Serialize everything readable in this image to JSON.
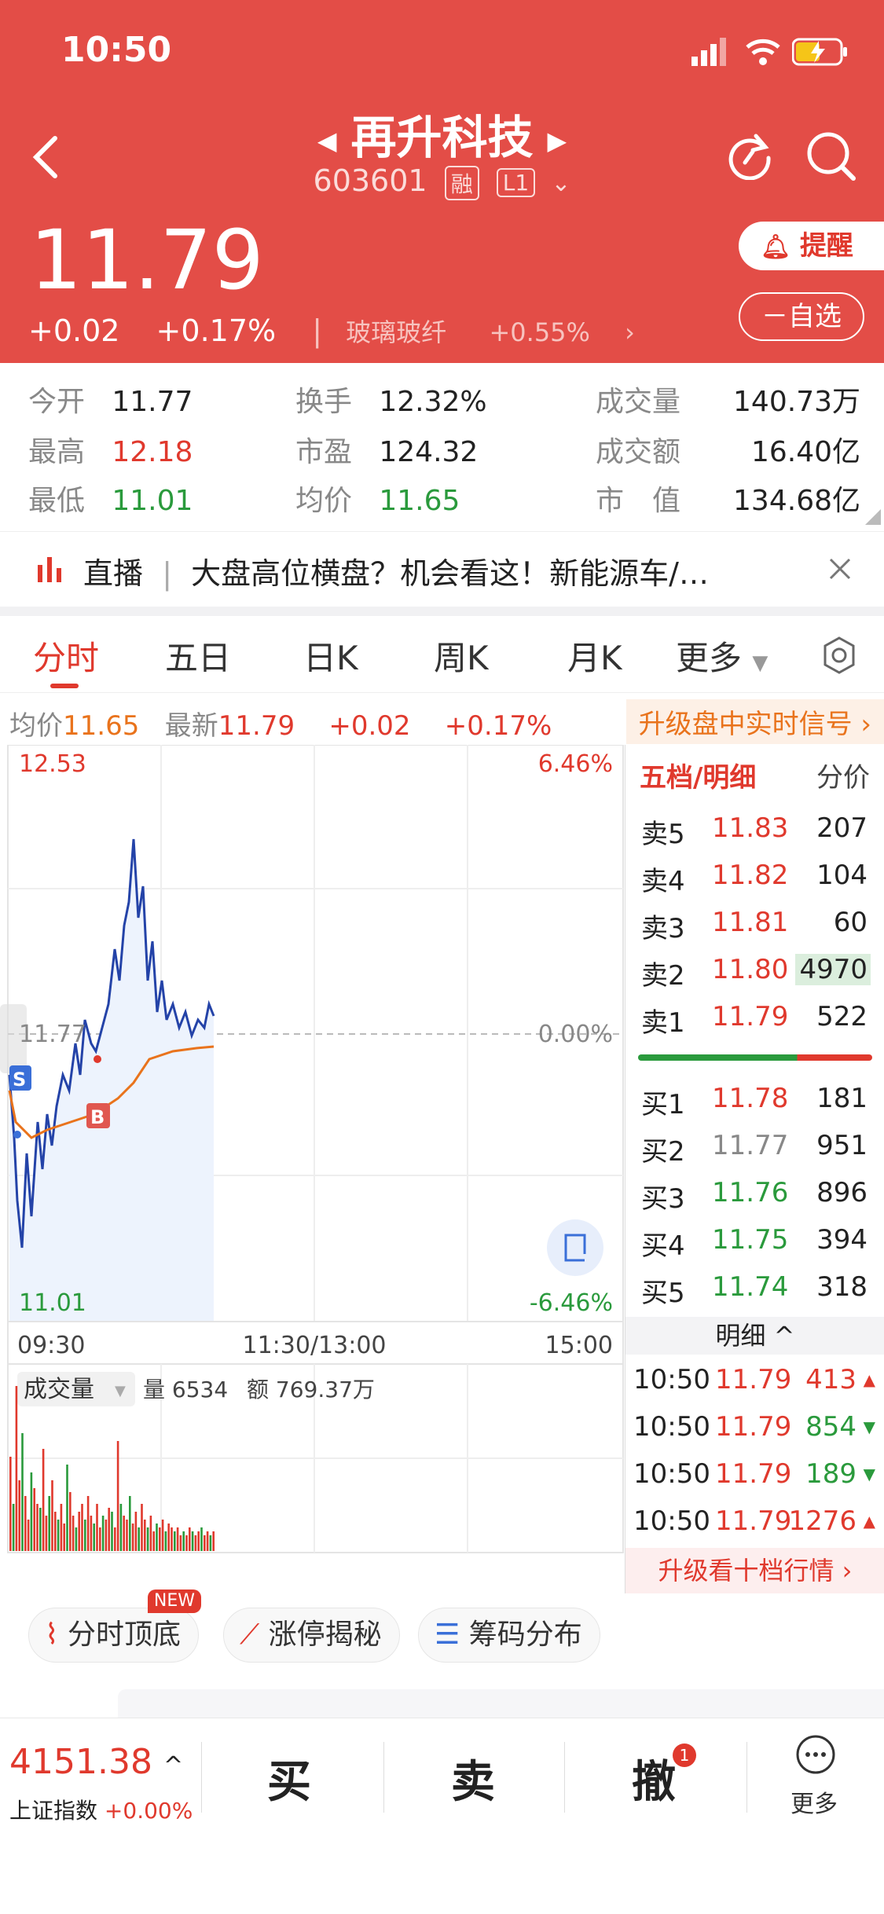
{
  "status": {
    "time": "10:50"
  },
  "stock": {
    "name": "再升科技",
    "code": "603601",
    "tag1": "融",
    "tag2": "L1",
    "price": "11.79",
    "change": "+0.02",
    "change_pct": "+0.17%",
    "sector": "玻璃玻纤",
    "sector_change": "+0.55%",
    "remind_label": "提醒",
    "watch_label": "自选"
  },
  "stats": {
    "open_label": "今开",
    "open": "11.77",
    "high_label": "最高",
    "high": "12.18",
    "low_label": "最低",
    "low": "11.01",
    "turnover_label": "换手",
    "turnover": "12.32%",
    "pe_label": "市盈",
    "pe": "124.32",
    "avg_label": "均价",
    "avg": "11.65",
    "volume_label": "成交量",
    "volume": "140.73万",
    "amount_label": "成交额",
    "amount": "16.40亿",
    "mcap_label": "市　值",
    "mcap": "134.68亿"
  },
  "banner": {
    "tag": "直播",
    "text": "大盘高位横盘？机会看这！新能源车/…"
  },
  "tabs": [
    "分时",
    "五日",
    "日K",
    "周K",
    "月K",
    "更多"
  ],
  "info_row": {
    "avg_label": "均价",
    "avg": "11.65",
    "latest_label": "最新",
    "latest": "11.79",
    "change": "+0.02",
    "change_pct": "+0.17%",
    "upgrade": "升级盘中实时信号 ›"
  },
  "chart": {
    "top_price": "12.53",
    "top_pct": "6.46%",
    "mid_price": "11.77",
    "mid_pct": "0.00%",
    "bottom_price": "11.01",
    "bottom_pct": "-6.46%",
    "time_start": "09:30",
    "time_mid": "11:30/13:00",
    "time_end": "15:00",
    "vol_label": "成交量",
    "vol_qty_label": "量",
    "vol_qty": "6534",
    "vol_amt_label": "额",
    "vol_amt": "769.37万",
    "marker_s": "S",
    "marker_b": "B"
  },
  "orderbook": {
    "tab1": "五档/明细",
    "tab2": "分价",
    "asks": [
      {
        "label": "卖5",
        "price": "11.83",
        "vol": "207"
      },
      {
        "label": "卖4",
        "price": "11.82",
        "vol": "104"
      },
      {
        "label": "卖3",
        "price": "11.81",
        "vol": "60"
      },
      {
        "label": "卖2",
        "price": "11.80",
        "vol": "4970"
      },
      {
        "label": "卖1",
        "price": "11.79",
        "vol": "522"
      }
    ],
    "bids": [
      {
        "label": "买1",
        "price": "11.78",
        "vol": "181"
      },
      {
        "label": "买2",
        "price": "11.77",
        "vol": "951"
      },
      {
        "label": "买3",
        "price": "11.76",
        "vol": "896"
      },
      {
        "label": "买4",
        "price": "11.75",
        "vol": "394"
      },
      {
        "label": "买5",
        "price": "11.74",
        "vol": "318"
      }
    ],
    "detail_label": "明细 ^",
    "ticks": [
      {
        "time": "10:50",
        "price": "11.79",
        "vol": "413"
      },
      {
        "time": "10:50",
        "price": "11.79",
        "vol": "854"
      },
      {
        "time": "10:50",
        "price": "11.79",
        "vol": "189"
      },
      {
        "time": "10:50",
        "price": "11.79",
        "vol": "1276"
      }
    ],
    "upgrade": "升级看十档行情 ›"
  },
  "pills": {
    "p1": "分时顶底",
    "p1_badge": "NEW",
    "p2": "涨停揭秘",
    "p3": "筹码分布"
  },
  "bottom": {
    "index_value": "4151.38",
    "index_arrow": "^",
    "index_name": "上证指数",
    "index_change": "+0.00%",
    "buy": "买",
    "sell": "卖",
    "cancel": "撤",
    "cancel_badge": "1",
    "more": "更多"
  }
}
